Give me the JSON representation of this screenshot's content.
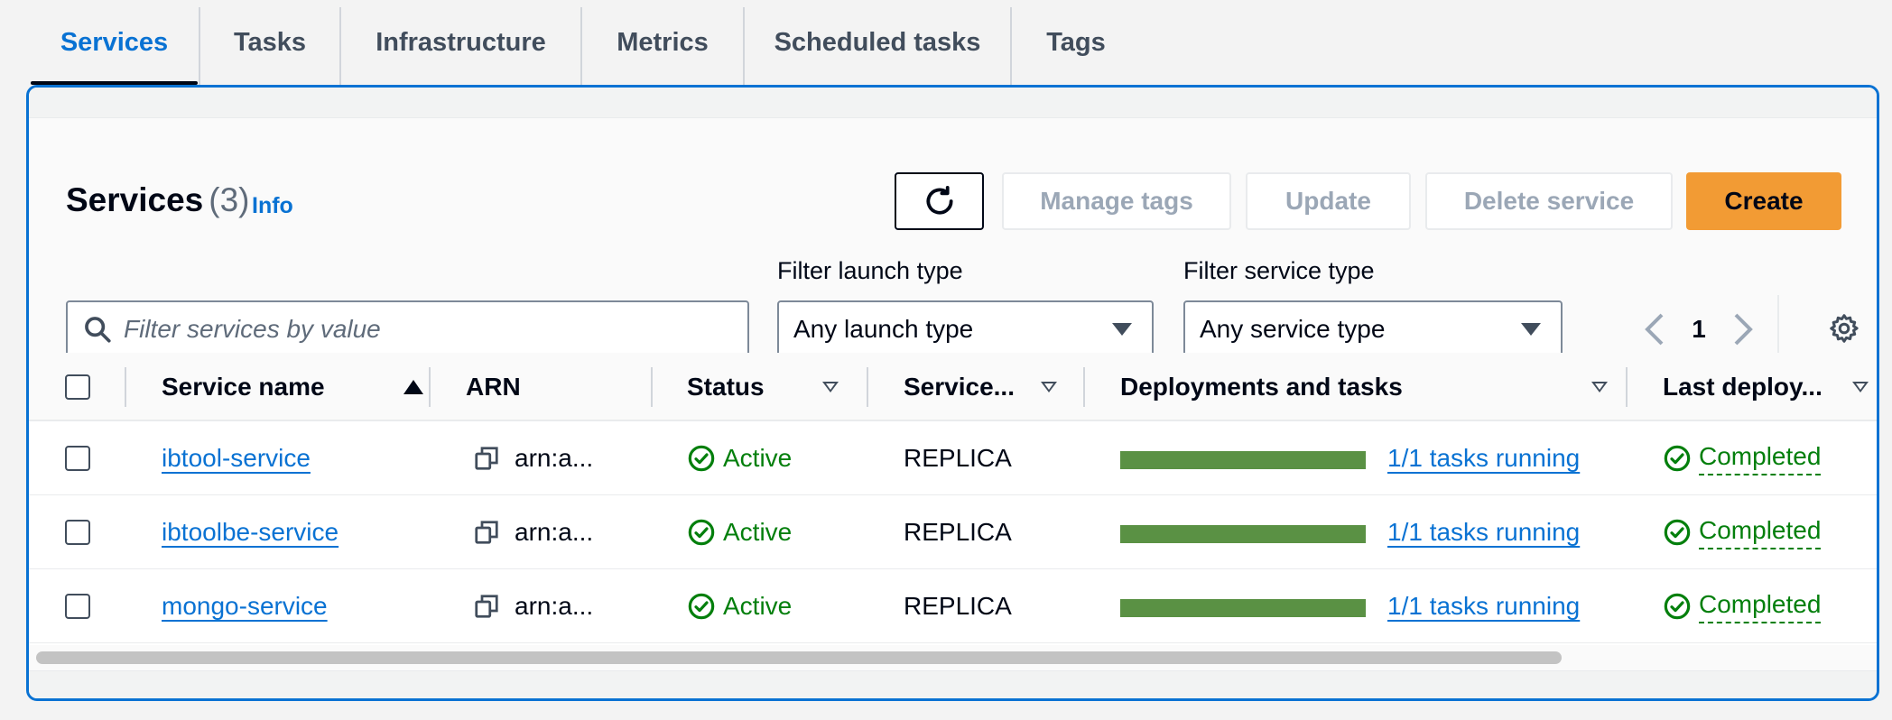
{
  "tabs": [
    {
      "label": "Services",
      "active": true
    },
    {
      "label": "Tasks",
      "active": false
    },
    {
      "label": "Infrastructure",
      "active": false
    },
    {
      "label": "Metrics",
      "active": false
    },
    {
      "label": "Scheduled tasks",
      "active": false
    },
    {
      "label": "Tags",
      "active": false
    }
  ],
  "header": {
    "title": "Services",
    "count": "(3)",
    "info_label": "Info"
  },
  "toolbar": {
    "refresh_icon": "refresh-icon",
    "manage_tags_label": "Manage tags",
    "update_label": "Update",
    "delete_label": "Delete service",
    "create_label": "Create"
  },
  "filters": {
    "search_placeholder": "Filter services by value",
    "search_value": "",
    "launch_type_label": "Filter launch type",
    "launch_type_value": "Any launch type",
    "service_type_label": "Filter service type",
    "service_type_value": "Any service type"
  },
  "pagination": {
    "current_page": "1"
  },
  "table": {
    "columns": [
      "Service name",
      "ARN",
      "Status",
      "Service...",
      "Deployments and tasks",
      "Last deploy..."
    ],
    "rows": [
      {
        "service_name": "ibtool-service",
        "arn": "arn:a...",
        "status": "Active",
        "service_type": "REPLICA",
        "tasks": "1/1 tasks running",
        "tasks_fraction": 1.0,
        "last_deployment": "Completed"
      },
      {
        "service_name": "ibtoolbe-service",
        "arn": "arn:a...",
        "status": "Active",
        "service_type": "REPLICA",
        "tasks": "1/1 tasks running",
        "tasks_fraction": 1.0,
        "last_deployment": "Completed"
      },
      {
        "service_name": "mongo-service",
        "arn": "arn:a...",
        "status": "Active",
        "service_type": "REPLICA",
        "tasks": "1/1 tasks running",
        "tasks_fraction": 1.0,
        "last_deployment": "Completed"
      }
    ]
  },
  "colors": {
    "accent": "#0972d3",
    "primary_button": "#f29b34",
    "success": "#037f0c",
    "progress": "#5a9144"
  }
}
